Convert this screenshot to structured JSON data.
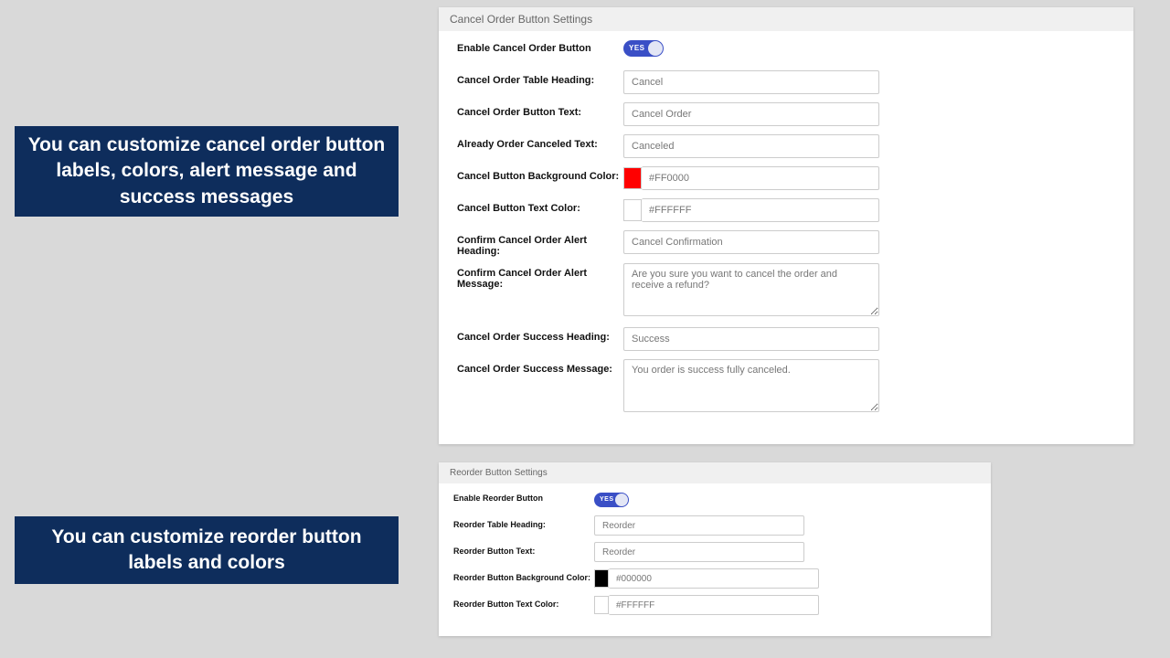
{
  "callouts": {
    "cancel": "You can customize cancel order button labels, colors, alert message and success messages",
    "reorder": "You can customize reorder button labels and colors"
  },
  "cancel_panel": {
    "title": "Cancel Order Button Settings",
    "labels": {
      "enable": "Enable Cancel Order Button",
      "table_heading": "Cancel Order Table Heading:",
      "button_text": "Cancel Order Button Text:",
      "already_text": "Already Order Canceled Text:",
      "bg_color": "Cancel Button Background Color:",
      "text_color": "Cancel Button Text Color:",
      "alert_heading": "Confirm Cancel Order Alert Heading:",
      "alert_message": "Confirm Cancel Order Alert Message:",
      "success_heading": "Cancel Order Success Heading:",
      "success_message": "Cancel Order Success Message:"
    },
    "toggle_text": "YES",
    "values": {
      "table_heading": "Cancel",
      "button_text": "Cancel Order",
      "already_text": "Canceled",
      "bg_color": "#FF0000",
      "text_color": "#FFFFFF",
      "alert_heading": "Cancel Confirmation",
      "alert_message": "Are you sure you want to cancel the order and receive a refund?",
      "success_heading": "Success",
      "success_message": "You order is success fully canceled."
    }
  },
  "reorder_panel": {
    "title": "Reorder Button Settings",
    "labels": {
      "enable": "Enable Reorder Button",
      "table_heading": "Reorder Table Heading:",
      "button_text": "Reorder Button Text:",
      "bg_color": "Reorder Button Background Color:",
      "text_color": "Reorder Button Text Color:"
    },
    "toggle_text": "YES",
    "values": {
      "table_heading": "Reorder",
      "button_text": "Reorder",
      "bg_color": "#000000",
      "text_color": "#FFFFFF"
    }
  }
}
